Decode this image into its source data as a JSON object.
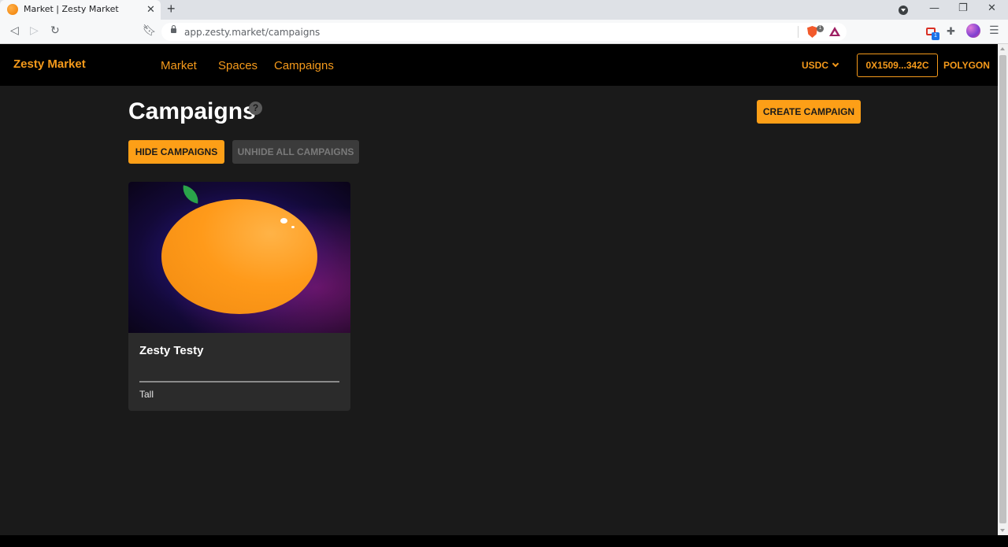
{
  "browser": {
    "tab_title": "Market | Zesty Market",
    "tab_close": "✕",
    "new_tab": "+",
    "url": "app.zesty.market/campaigns",
    "shield_count": "1",
    "gift_count": "1"
  },
  "nav": {
    "brand": "Zesty Market",
    "links": [
      "Market",
      "Spaces",
      "Campaigns"
    ],
    "currency": "USDC",
    "wallet": "0X1509...342C",
    "network": "POLYGON",
    "accent_color": "#f59a1b"
  },
  "main": {
    "title": "Campaigns",
    "help": "?",
    "create_button": "CREATE CAMPAIGN",
    "hide_button": "HIDE CAMPAIGNS",
    "unhide_button": "UNHIDE ALL CAMPAIGNS"
  },
  "campaigns": [
    {
      "title": "Zesty Testy",
      "subtitle": "Tall"
    }
  ]
}
